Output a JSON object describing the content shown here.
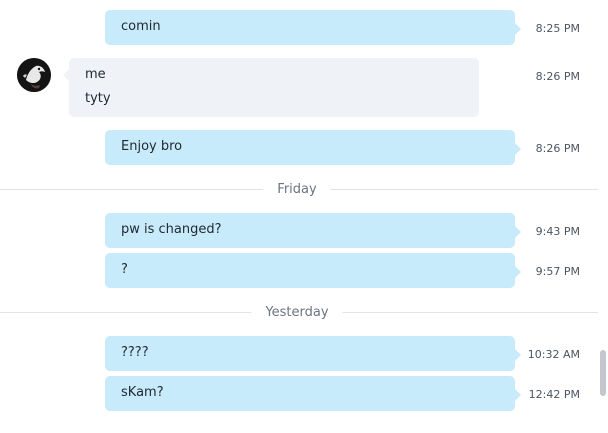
{
  "messages": {
    "m1": {
      "text": "comin",
      "time": "8:25 PM"
    },
    "m2": {
      "sender": "me",
      "text": "tyty",
      "time": "8:26 PM"
    },
    "m3": {
      "text": "Enjoy bro",
      "time": "8:26 PM"
    },
    "m4": {
      "text": "pw is changed?",
      "time": "9:43 PM"
    },
    "m5": {
      "text": "?",
      "time": "9:57 PM"
    },
    "m6": {
      "text": "????",
      "time": "10:32 AM"
    },
    "m7": {
      "text": "sKam?",
      "time": "12:42 PM"
    }
  },
  "dividers": {
    "d1": "Friday",
    "d2": "Yesterday"
  },
  "colors": {
    "outgoing_bubble": "#c8ebfb",
    "incoming_bubble": "#eff2f7",
    "divider_line": "#dfe3e8"
  },
  "icons": {
    "avatar": "user-avatar"
  }
}
